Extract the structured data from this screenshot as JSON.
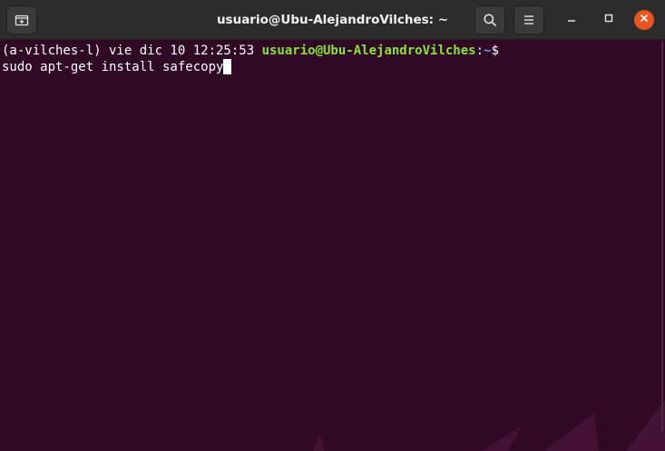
{
  "window": {
    "title": "usuario@Ubu-AlejandroVilches: ~"
  },
  "titlebar": {
    "new_tab_icon": "new-tab-icon",
    "search_icon": "search-icon",
    "menu_icon": "hamburger-menu-icon",
    "minimize_icon": "minimize-icon",
    "maximize_icon": "maximize-icon",
    "close_icon": "close-icon"
  },
  "terminal": {
    "line1": {
      "env": "(a-vilches-l) vie dic 10 12:25:53 ",
      "user_host": "usuario@Ubu-AlejandroVilches",
      "colon": ":",
      "path": "~",
      "symbol": "$"
    },
    "line2": {
      "command": "sudo apt-get install safecopy"
    }
  },
  "colors": {
    "background": "#300a24",
    "titlebar": "#2c2c2c",
    "prompt_user": "#8ae234",
    "prompt_path": "#729fcf",
    "text": "#ffffff",
    "close_button": "#e95420"
  }
}
